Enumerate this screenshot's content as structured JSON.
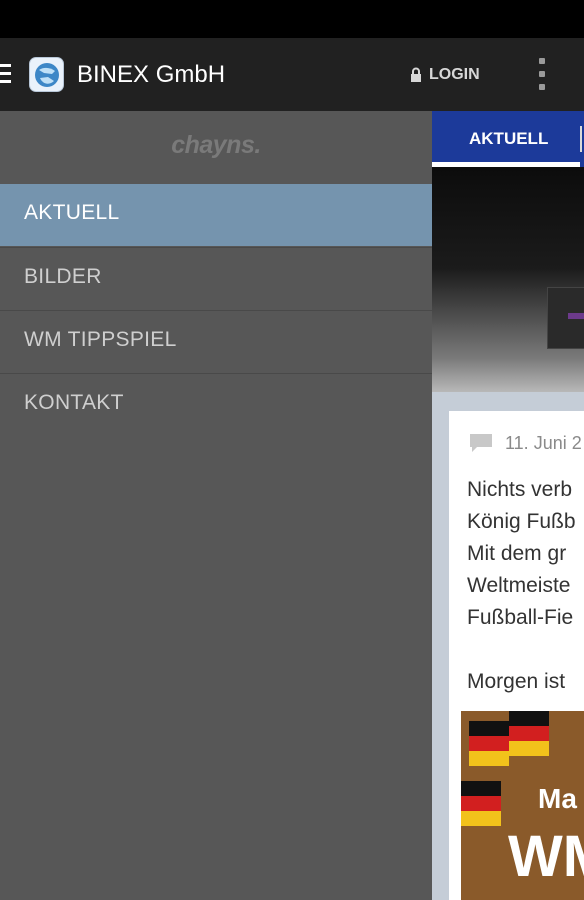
{
  "app": {
    "title": "BINEX GmbH",
    "login_label": "LOGIN"
  },
  "drawer": {
    "brand": "chayns.",
    "items": [
      {
        "label": "AKTUELL",
        "active": true
      },
      {
        "label": "BILDER"
      },
      {
        "label": "WM TIPPSPIEL"
      },
      {
        "label": "KONTAKT"
      }
    ]
  },
  "content": {
    "active_tab": "AKTUELL",
    "post": {
      "date": "11. Juni 2",
      "lines": [
        "Nichts verb",
        "König Fußb",
        "Mit dem gr",
        "Weltmeiste",
        "Fußball-Fie",
        "Morgen ist"
      ],
      "image_text_1": "Ma",
      "image_text_2": "WM"
    }
  },
  "colors": {
    "action_bar": "#212121",
    "drawer_bg": "#575757",
    "drawer_active": "#7594ae",
    "tab_bar": "#1c3a9a"
  }
}
